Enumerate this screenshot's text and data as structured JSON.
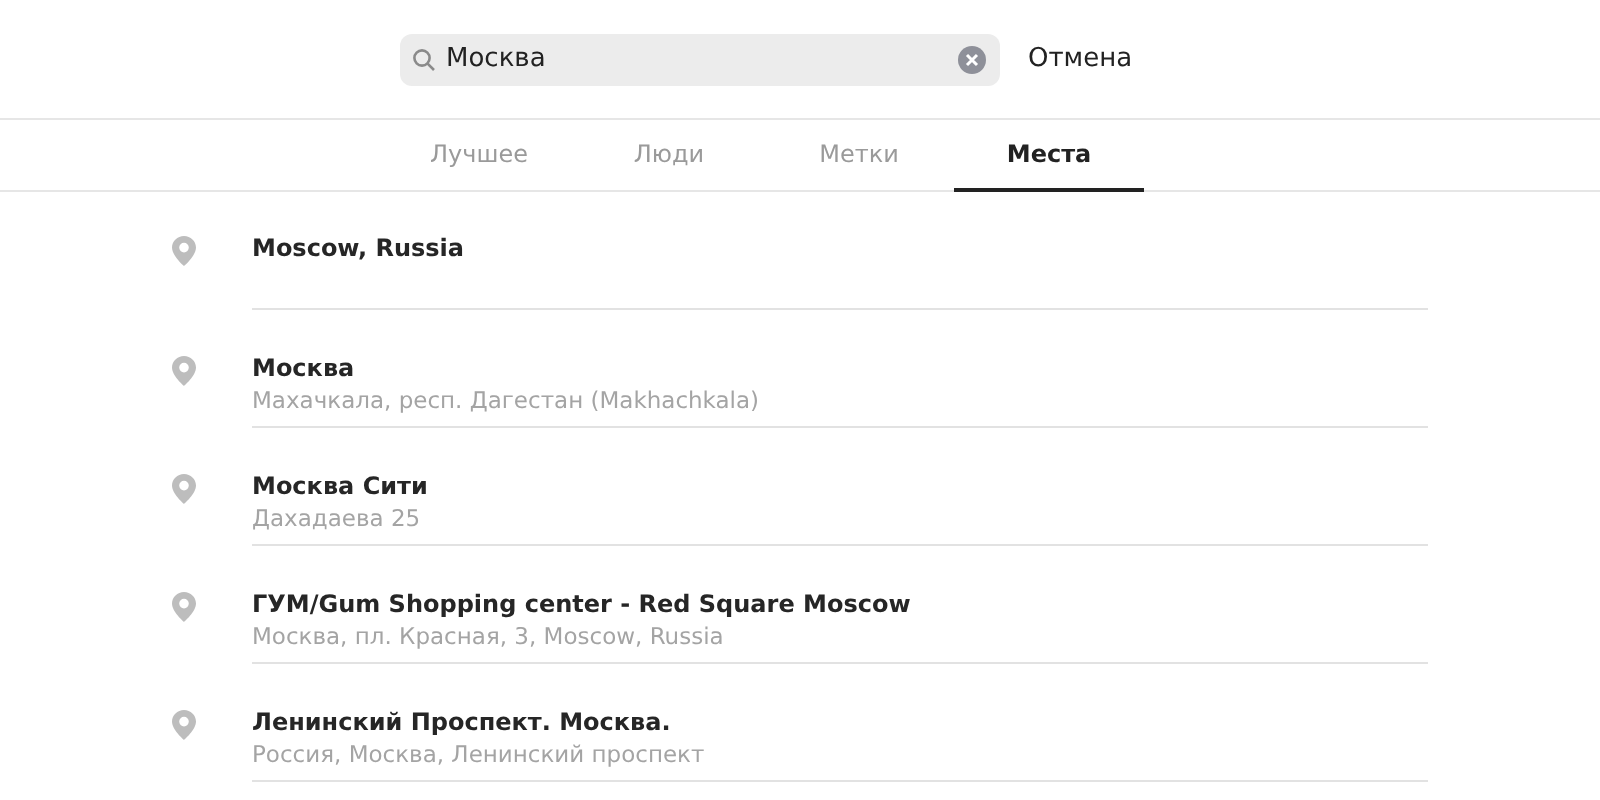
{
  "search": {
    "value": "Москва",
    "cancel": "Отмена"
  },
  "tabs": [
    {
      "label": "Лучшее",
      "selected": false
    },
    {
      "label": "Люди",
      "selected": false
    },
    {
      "label": "Метки",
      "selected": false
    },
    {
      "label": "Места",
      "selected": true
    }
  ],
  "places": [
    {
      "name": "Moscow, Russia"
    },
    {
      "name": "Москва",
      "address": "Махачкала, респ. Дагестан (Makhachkala)"
    },
    {
      "name": "Москва Сити",
      "address": "Дахадаева 25"
    },
    {
      "name": "ГУМ/Gum Shopping center - Red Square Moscow",
      "address": "Москва, пл. Красная, 3, Moscow, Russia"
    },
    {
      "name": "Ленинский Проспект. Москва.",
      "address": "Россия, Москва, Ленинский проспект"
    }
  ]
}
